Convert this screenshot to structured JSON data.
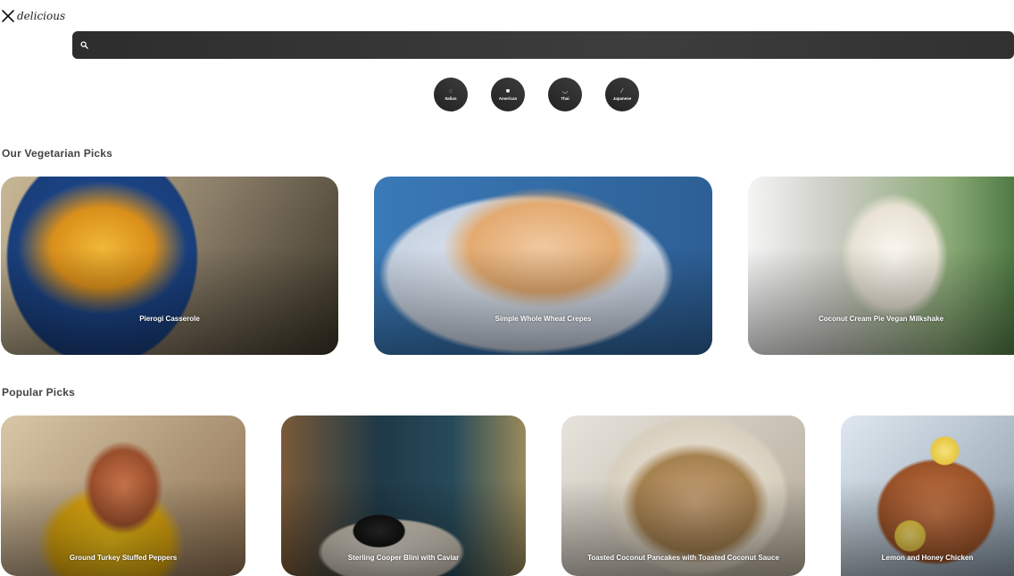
{
  "header": {
    "logo_text": "delicious",
    "logo_icon": "fork-knife-icon"
  },
  "search": {
    "placeholder": "",
    "value": "",
    "icon": "search-icon"
  },
  "categories": [
    {
      "label": "Italian",
      "icon": "pizza-icon"
    },
    {
      "label": "American",
      "icon": "burger-icon"
    },
    {
      "label": "Thai",
      "icon": "noodle-bowl-icon"
    },
    {
      "label": "Japanese",
      "icon": "chopsticks-icon"
    }
  ],
  "vegetarian": {
    "title": "Our Vegetarian Picks",
    "items": [
      {
        "name": "Pierogi Casserole"
      },
      {
        "name": "Simple Whole Wheat Crepes"
      },
      {
        "name": "Coconut Cream Pie Vegan Milkshake"
      }
    ]
  },
  "popular": {
    "title": "Popular Picks",
    "items": [
      {
        "name": "Ground Turkey Stuffed Peppers"
      },
      {
        "name": "Sterling Cooper Blini with Caviar"
      },
      {
        "name": "Toasted Coconut Pancakes with Toasted Coconut Sauce"
      },
      {
        "name": "Lemon and Honey Chicken"
      }
    ]
  },
  "colors": {
    "search_bg": "#333333",
    "category_bg": "#2b2b2b",
    "text": "#333333"
  }
}
